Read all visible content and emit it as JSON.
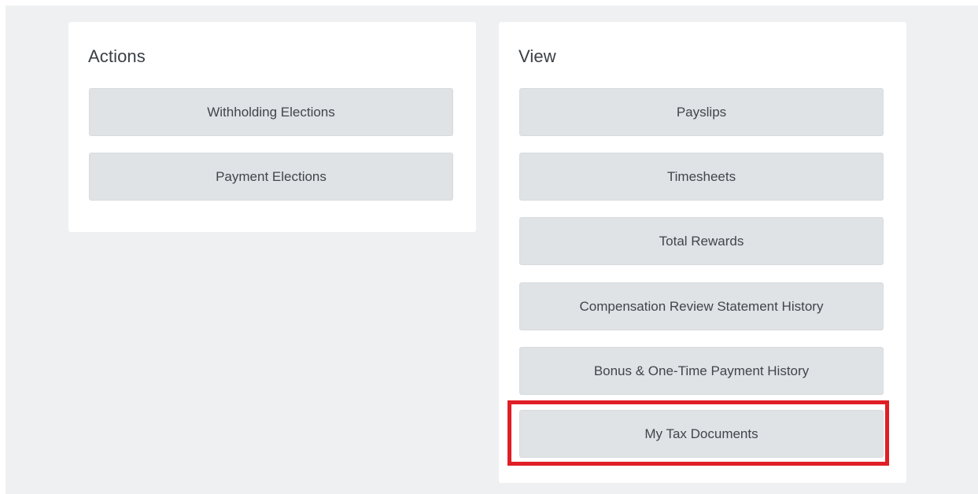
{
  "actions": {
    "title": "Actions",
    "buttons": [
      "Withholding Elections",
      "Payment Elections"
    ]
  },
  "view": {
    "title": "View",
    "buttons": [
      "Payslips",
      "Timesheets",
      "Total Rewards",
      "Compensation Review Statement History",
      "Bonus & One-Time Payment History",
      "My Tax Documents"
    ]
  },
  "colors": {
    "highlight": "#e01e25",
    "button_bg": "#dfe3e6",
    "page_bg": "#eef0f2"
  }
}
